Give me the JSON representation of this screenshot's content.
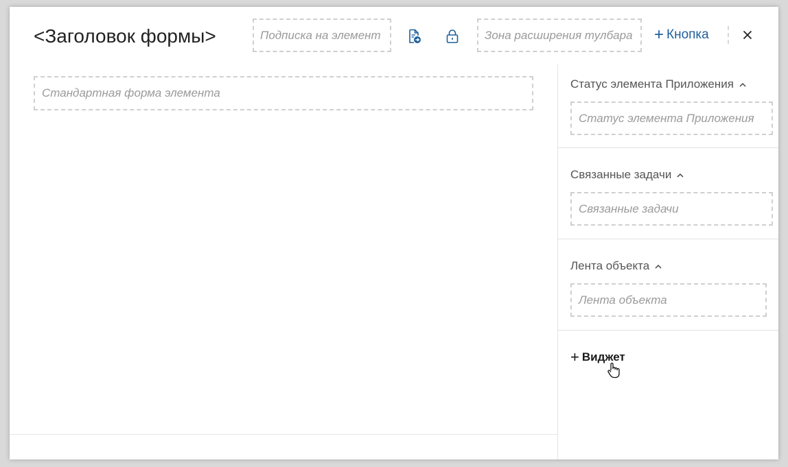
{
  "header": {
    "title": "<Заголовок формы>",
    "subscription_zone": "Подписка на элемент",
    "toolbar_zone": "Зона расширения тулбара",
    "add_button": "Кнопка",
    "add_button_prefix": "+",
    "icons": [
      "document-arrow-icon",
      "lock-icon",
      "close-icon"
    ]
  },
  "main": {
    "standard_form": "Стандартная форма элемента"
  },
  "sidebar": {
    "sections": [
      {
        "title": "Статус элемента Приложения",
        "placeholder": "Статус элемента Приложения"
      },
      {
        "title": "Связанные задачи",
        "placeholder": "Связанные задачи"
      },
      {
        "title": "Лента объекта",
        "placeholder": "Лента объекта"
      }
    ],
    "widget_prefix": "+",
    "widget_button": "Виджет"
  },
  "colors": {
    "accent": "#1f5f9a",
    "dashed_border": "#cfcfcf",
    "placeholder_text": "#9a9a9a"
  }
}
